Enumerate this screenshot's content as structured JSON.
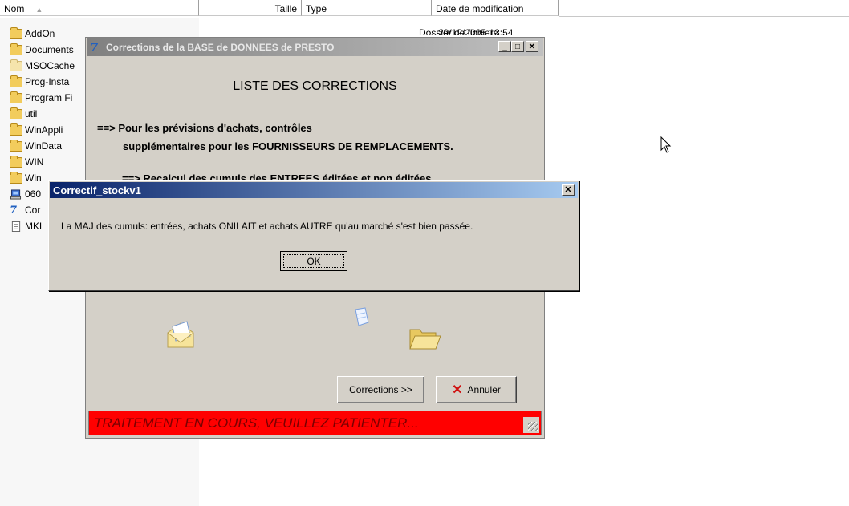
{
  "explorer": {
    "columns": {
      "name": "Nom",
      "size": "Taille",
      "type": "Type",
      "date": "Date de modification"
    },
    "files": [
      {
        "name": "AddOn",
        "icon": "folder-icon"
      },
      {
        "name": "Documents",
        "icon": "folder-icon"
      },
      {
        "name": "MSOCache",
        "icon": "folder-hidden-icon"
      },
      {
        "name": "Prog-Insta",
        "icon": "folder-icon"
      },
      {
        "name": "Program Fi",
        "icon": "folder-icon"
      },
      {
        "name": "util",
        "icon": "folder-icon"
      },
      {
        "name": "WinAppli",
        "icon": "folder-icon"
      },
      {
        "name": "WinData",
        "icon": "folder-icon"
      },
      {
        "name": "WIN",
        "icon": "folder-icon"
      },
      {
        "name": "Win",
        "icon": "folder-icon"
      },
      {
        "name": "060",
        "icon": "computer-file-icon"
      },
      {
        "name": "Cor",
        "icon": "app-icon"
      },
      {
        "name": "MKL",
        "icon": "text-file-icon"
      }
    ],
    "first_row": {
      "type": "Dossier de fichiers",
      "date": "29/12/2005 13:54"
    }
  },
  "main_dialog": {
    "title": "Corrections de la BASE de DONNEES de PRESTO",
    "heading": "LISTE DES CORRECTIONS",
    "line1": "==> Pour les prévisions d'achats, contrôles",
    "line2": "supplémentaires pour les FOURNISSEURS DE REMPLACEMENTS.",
    "line3": "==> Recalcul des cumuls des ENTREES éditées et non éditées",
    "corrections_button": "Corrections >>",
    "cancel_button": "Annuler",
    "status": "TRAITEMENT EN COURS, VEUILLEZ PATIENTER...",
    "status_color": "#ff0000"
  },
  "message_box": {
    "title": "Correctif_stockv1",
    "message": "La MAJ des cumuls: entrées, achats ONILAIT et achats AUTRE qu'au marché s'est bien passée.",
    "ok_button": "OK",
    "title_color": "#0a246a"
  }
}
